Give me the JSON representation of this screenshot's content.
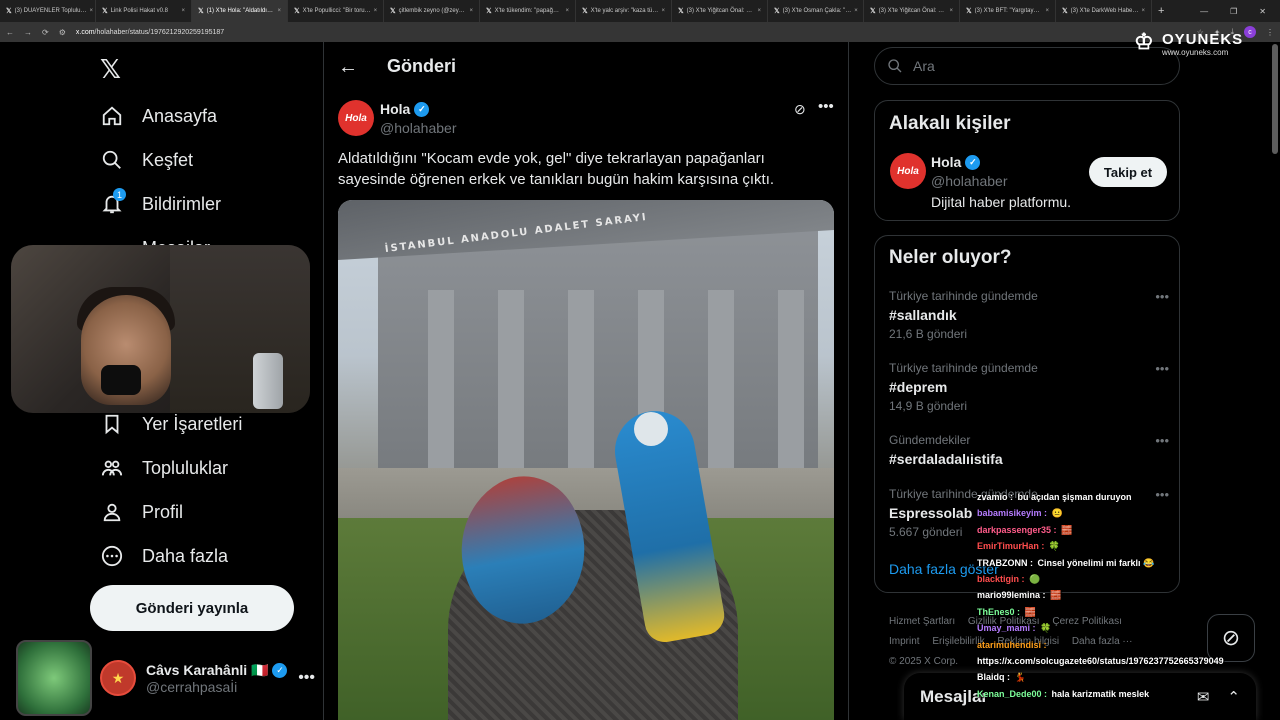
{
  "browser": {
    "tabs": [
      {
        "title": "(3) DUAYENLER Toplulu…",
        "active": false
      },
      {
        "title": "Link Polisi Hakat v0.8",
        "active": false
      },
      {
        "title": "(1) X'te Hola: \"Aldatıldı…",
        "active": true
      },
      {
        "title": "X'te Popullicci: \"Bir toru…",
        "active": false
      },
      {
        "title": "çitlembik zeyno (@zey…",
        "active": false
      },
      {
        "title": "X'te tükendim: \"papağ…",
        "active": false
      },
      {
        "title": "X'te yalc arşiv: \"kaza tü…",
        "active": false
      },
      {
        "title": "(3) X'te Yiğitcan Önal: …",
        "active": false
      },
      {
        "title": "(3) X'te Osman Çakla: \"…",
        "active": false
      },
      {
        "title": "(3) X'te Yiğitcan Önal: …",
        "active": false
      },
      {
        "title": "(3) X'te BFT: \"Yargıtay…",
        "active": false
      },
      {
        "title": "(3) X'te DarkWeb Habe…",
        "active": false
      }
    ],
    "url_host": "x.com",
    "url_path": "/holahaber/status/1976212920259195187",
    "profile_initial": "c"
  },
  "nav": {
    "items": [
      {
        "label": "Anasayfa",
        "icon": "home-icon"
      },
      {
        "label": "Keşfet",
        "icon": "search-icon"
      },
      {
        "label": "Bildirimler",
        "icon": "bell-icon",
        "badge": "1"
      },
      {
        "label": "Mesajlar",
        "icon": "mail-icon"
      },
      {
        "label": "Yer İşaretleri",
        "icon": "bookmark-icon"
      },
      {
        "label": "Topluluklar",
        "icon": "communities-icon"
      },
      {
        "label": "Profil",
        "icon": "profile-icon"
      },
      {
        "label": "Daha fazla",
        "icon": "more-circle-icon"
      }
    ],
    "post_button": "Gönderi yayınla",
    "account": {
      "name": "Câvs Karahânli 🇮🇹",
      "handle": "@cerrahpasaİi"
    }
  },
  "main": {
    "header_title": "Gönderi",
    "tweet": {
      "avatar_text": "Hola",
      "name": "Hola",
      "handle": "@holahaber",
      "text": "Aldatıldığını \"Kocam evde yok, gel\" diye tekrarlayan papağanları sayesinde öğrenen erkek ve tanıkları bugün hakim karşısına çıktı.",
      "image_sign": "İSTANBUL ANADOLU ADALET SARAYI"
    }
  },
  "sidebar": {
    "search_placeholder": "Ara",
    "related": {
      "title": "Alakalı kişiler",
      "name": "Hola",
      "handle": "@holahaber",
      "bio": "Dijital haber platformu.",
      "follow": "Takip et"
    },
    "trends": {
      "title": "Neler oluyor?",
      "items": [
        {
          "context": "Türkiye tarihinde gündemde",
          "tag": "#sallandık",
          "count": "21,6 B gönderi"
        },
        {
          "context": "Türkiye tarihinde gündemde",
          "tag": "#deprem",
          "count": "14,9 B gönderi"
        },
        {
          "context": "Gündemdekiler",
          "tag": "#serdaladalıistifa",
          "count": ""
        },
        {
          "context": "Türkiye tarihinde gündemde",
          "tag": "Espressolab",
          "count": "5.667 gönderi"
        }
      ],
      "show_more": "Daha fazla göster"
    },
    "footer_links": [
      "Hizmet Şartları",
      "Gizlilik Politikası",
      "Çerez Politikası",
      "Imprint",
      "Erişilebilirlik",
      "Reklam bilgisi",
      "Daha fazla ···",
      "© 2025 X Corp."
    ],
    "messages_drawer": "Mesajlar"
  },
  "brand": {
    "name": "OYUNEKS",
    "url": "www.oyuneks.com"
  },
  "chat": [
    {
      "user": "zvamio",
      "color": "#ffffff",
      "msg": "bu açıdan şişman duruyon"
    },
    {
      "user": "babamisikeyim",
      "color": "#b57cff",
      "msg": "😐"
    },
    {
      "user": "darkpassenger35",
      "color": "#ff5c8a",
      "msg": "🧱"
    },
    {
      "user": "EmirTimurHan",
      "color": "#ff4d4d",
      "msg": "🍀"
    },
    {
      "user": "TRABZONN",
      "color": "#ffffff",
      "msg": "Cinsel yönelimi mi farklı 😂"
    },
    {
      "user": "blacktigin",
      "color": "#ff4d4d",
      "msg": "🟢"
    },
    {
      "user": "mario99lemina",
      "color": "#ffffff",
      "msg": "🧱"
    },
    {
      "user": "ThEnes0",
      "color": "#7dff9a",
      "msg": "🧱"
    },
    {
      "user": "Umay_mami",
      "color": "#b57cff",
      "msg": "🍀"
    },
    {
      "user": "atarimuhendisi",
      "color": "#ff9f1a",
      "msg": ""
    },
    {
      "user": "",
      "color": "#ffffff",
      "msg": "https://x.com/solcugazete60/status/1976237752665379049"
    },
    {
      "user": "Blaidq",
      "color": "#ffffff",
      "msg": "💃"
    },
    {
      "user": "Kenan_Dede00",
      "color": "#7dff9a",
      "msg": "hala karizmatik meslek"
    }
  ]
}
